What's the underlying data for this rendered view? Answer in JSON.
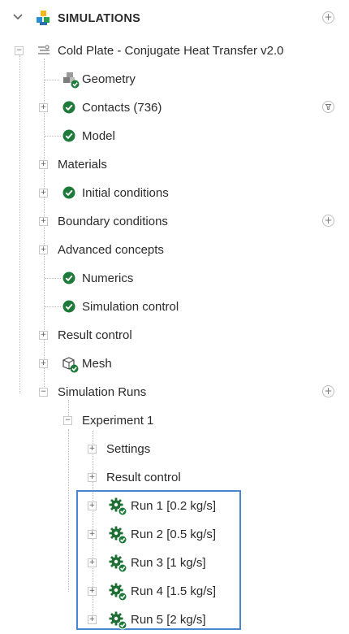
{
  "header": {
    "chevron": "chevron-down-icon",
    "title": "SIMULATIONS",
    "add": "+"
  },
  "tree": {
    "root": "Cold Plate - Conjugate Heat Transfer v2.0",
    "geometry": "Geometry",
    "contacts": "Contacts (736)",
    "model": "Model",
    "materials": "Materials",
    "initial_conditions": "Initial conditions",
    "boundary_conditions": "Boundary conditions",
    "advanced_concepts": "Advanced concepts",
    "numerics": "Numerics",
    "simulation_control": "Simulation control",
    "result_control": "Result control",
    "mesh": "Mesh",
    "simulation_runs": "Simulation Runs",
    "experiment": "Experiment 1",
    "exp_settings": "Settings",
    "exp_result_control": "Result control",
    "runs": [
      "Run 1 [0.2 kg/s]",
      "Run 2 [0.5 kg/s]",
      "Run 3 [1 kg/s]",
      "Run 4 [1.5 kg/s]",
      "Run 5 [2 kg/s]"
    ]
  },
  "colors": {
    "accent_check": "#1e7a3a",
    "highlight_border": "#4a86d0",
    "gear": "#1f6f35"
  }
}
